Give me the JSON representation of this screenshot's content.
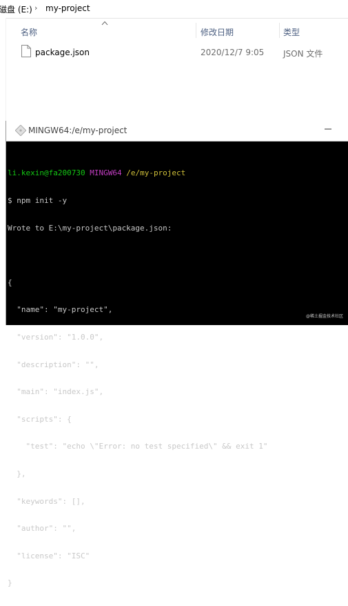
{
  "explorer": {
    "breadcrumb": {
      "drive": "磁盘 (E:)",
      "separator": "›",
      "folder": "my-project"
    },
    "columns": {
      "name": "名称",
      "modified": "修改日期",
      "type": "类型"
    },
    "files": [
      {
        "name": "package.json",
        "modified": "2020/12/7 9:05",
        "type": "JSON 文件",
        "icon": "document-icon"
      }
    ]
  },
  "terminal": {
    "title": "MINGW64:/e/my-project",
    "prompt": {
      "user_host": "li.kexin@fa200730",
      "env": "MINGW64",
      "path": "/e/my-project"
    },
    "lines": [
      "$ npm init -y",
      "Wrote to E:\\my-project\\package.json:",
      "",
      "{",
      "  \"name\": \"my-project\",",
      "  \"version\": \"1.0.0\",",
      "  \"description\": \"\",",
      "  \"main\": \"index.js\",",
      "  \"scripts\": {",
      "    \"test\": \"echo \\\"Error: no test specified\\\" && exit 1\"",
      "  },",
      "  \"keywords\": [],",
      "  \"author\": \"\",",
      "  \"license\": \"ISC\"",
      "}"
    ],
    "watermark": "@稀土掘金技术社区"
  },
  "colors": {
    "terminal_bg": "#000000",
    "prompt_green": "#14c814",
    "prompt_magenta": "#c33ec3",
    "prompt_yellow": "#d2c23a",
    "header_text": "#4d6082"
  }
}
